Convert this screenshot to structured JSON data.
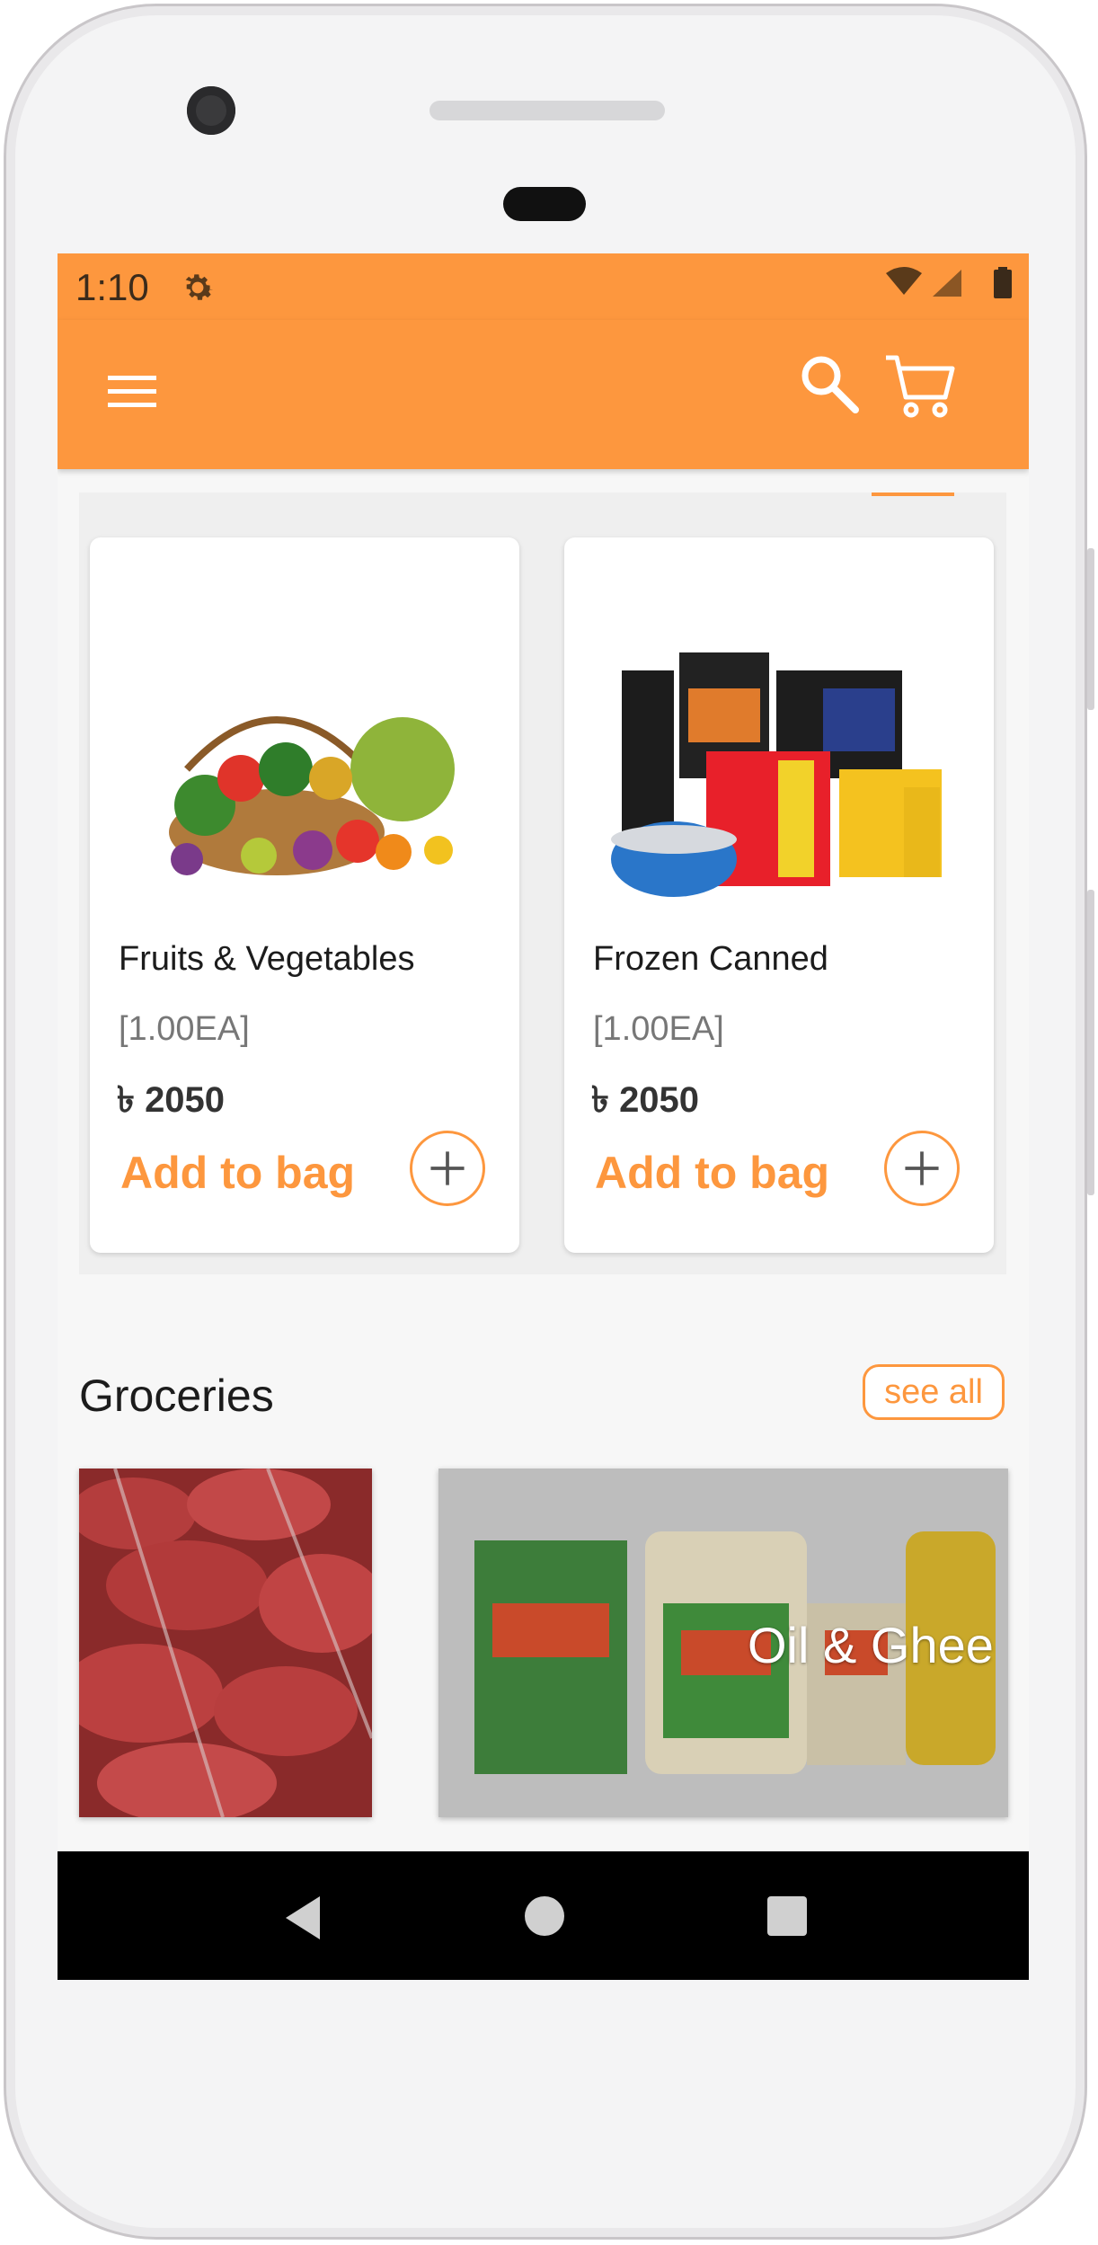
{
  "status_bar": {
    "time": "1:10",
    "icons": [
      "gear-icon",
      "wifi-icon",
      "signal-icon",
      "battery-icon"
    ]
  },
  "app_bar": {
    "icons": [
      "menu-icon",
      "search-icon",
      "cart-icon"
    ]
  },
  "products": [
    {
      "name": "Fruits & Vegetables",
      "qty": "[1.00EA]",
      "currency": "৳",
      "price": "2050",
      "add_label": "Add to bag"
    },
    {
      "name": "Frozen Canned",
      "qty": "[1.00EA]",
      "currency": "৳",
      "price": "2050",
      "add_label": "Add to bag"
    }
  ],
  "groceries": {
    "title": "Groceries",
    "see_all": "see all",
    "categories": [
      {
        "label": ""
      },
      {
        "label": "Oil & Ghee"
      }
    ]
  },
  "colors": {
    "accent": "#fd973e",
    "nav_bar": "#000000"
  }
}
